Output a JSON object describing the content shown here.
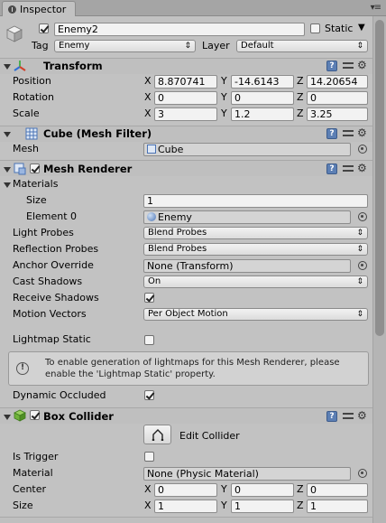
{
  "tab": {
    "title": "Inspector"
  },
  "object": {
    "name": "Enemy2",
    "static_label": "Static",
    "tag_label": "Tag",
    "tag_value": "Enemy",
    "layer_label": "Layer",
    "layer_value": "Default"
  },
  "transform": {
    "title": "Transform",
    "position": {
      "label": "Position",
      "x": "8.870741",
      "y": "-14.6143",
      "z": "14.20654"
    },
    "rotation": {
      "label": "Rotation",
      "x": "0",
      "y": "0",
      "z": "0"
    },
    "scale": {
      "label": "Scale",
      "x": "3",
      "y": "1.2",
      "z": "3.25"
    }
  },
  "axis": {
    "x": "X",
    "y": "Y",
    "z": "Z"
  },
  "mesh_filter": {
    "title": "Cube (Mesh Filter)",
    "mesh_label": "Mesh",
    "mesh_value": "Cube"
  },
  "mesh_renderer": {
    "title": "Mesh Renderer",
    "materials_label": "Materials",
    "size_label": "Size",
    "size_value": "1",
    "element_label": "Element 0",
    "element_value": "Enemy",
    "light_probes_label": "Light Probes",
    "light_probes_value": "Blend Probes",
    "reflection_probes_label": "Reflection Probes",
    "reflection_probes_value": "Blend Probes",
    "anchor_label": "Anchor Override",
    "anchor_value": "None (Transform)",
    "cast_shadows_label": "Cast Shadows",
    "cast_shadows_value": "On",
    "receive_shadows_label": "Receive Shadows",
    "motion_vectors_label": "Motion Vectors",
    "motion_vectors_value": "Per Object Motion",
    "lightmap_static_label": "Lightmap Static",
    "help_text": "To enable generation of lightmaps for this Mesh Renderer, please enable the 'Lightmap Static' property.",
    "dynamic_occluded_label": "Dynamic Occluded"
  },
  "box_collider": {
    "title": "Box Collider",
    "edit_label": "Edit Collider",
    "is_trigger_label": "Is Trigger",
    "material_label": "Material",
    "material_value": "None (Physic Material)",
    "center": {
      "label": "Center",
      "x": "0",
      "y": "0",
      "z": "0"
    },
    "size": {
      "label": "Size",
      "x": "1",
      "y": "1",
      "z": "1"
    }
  },
  "colors": {
    "background": "#c2c2c2",
    "help_icon": "#5c7fb4",
    "transform_icon_red": "#d0402a",
    "mesh_icon_blue": "#4a73b5",
    "collider_icon_green": "#5aa02c"
  }
}
